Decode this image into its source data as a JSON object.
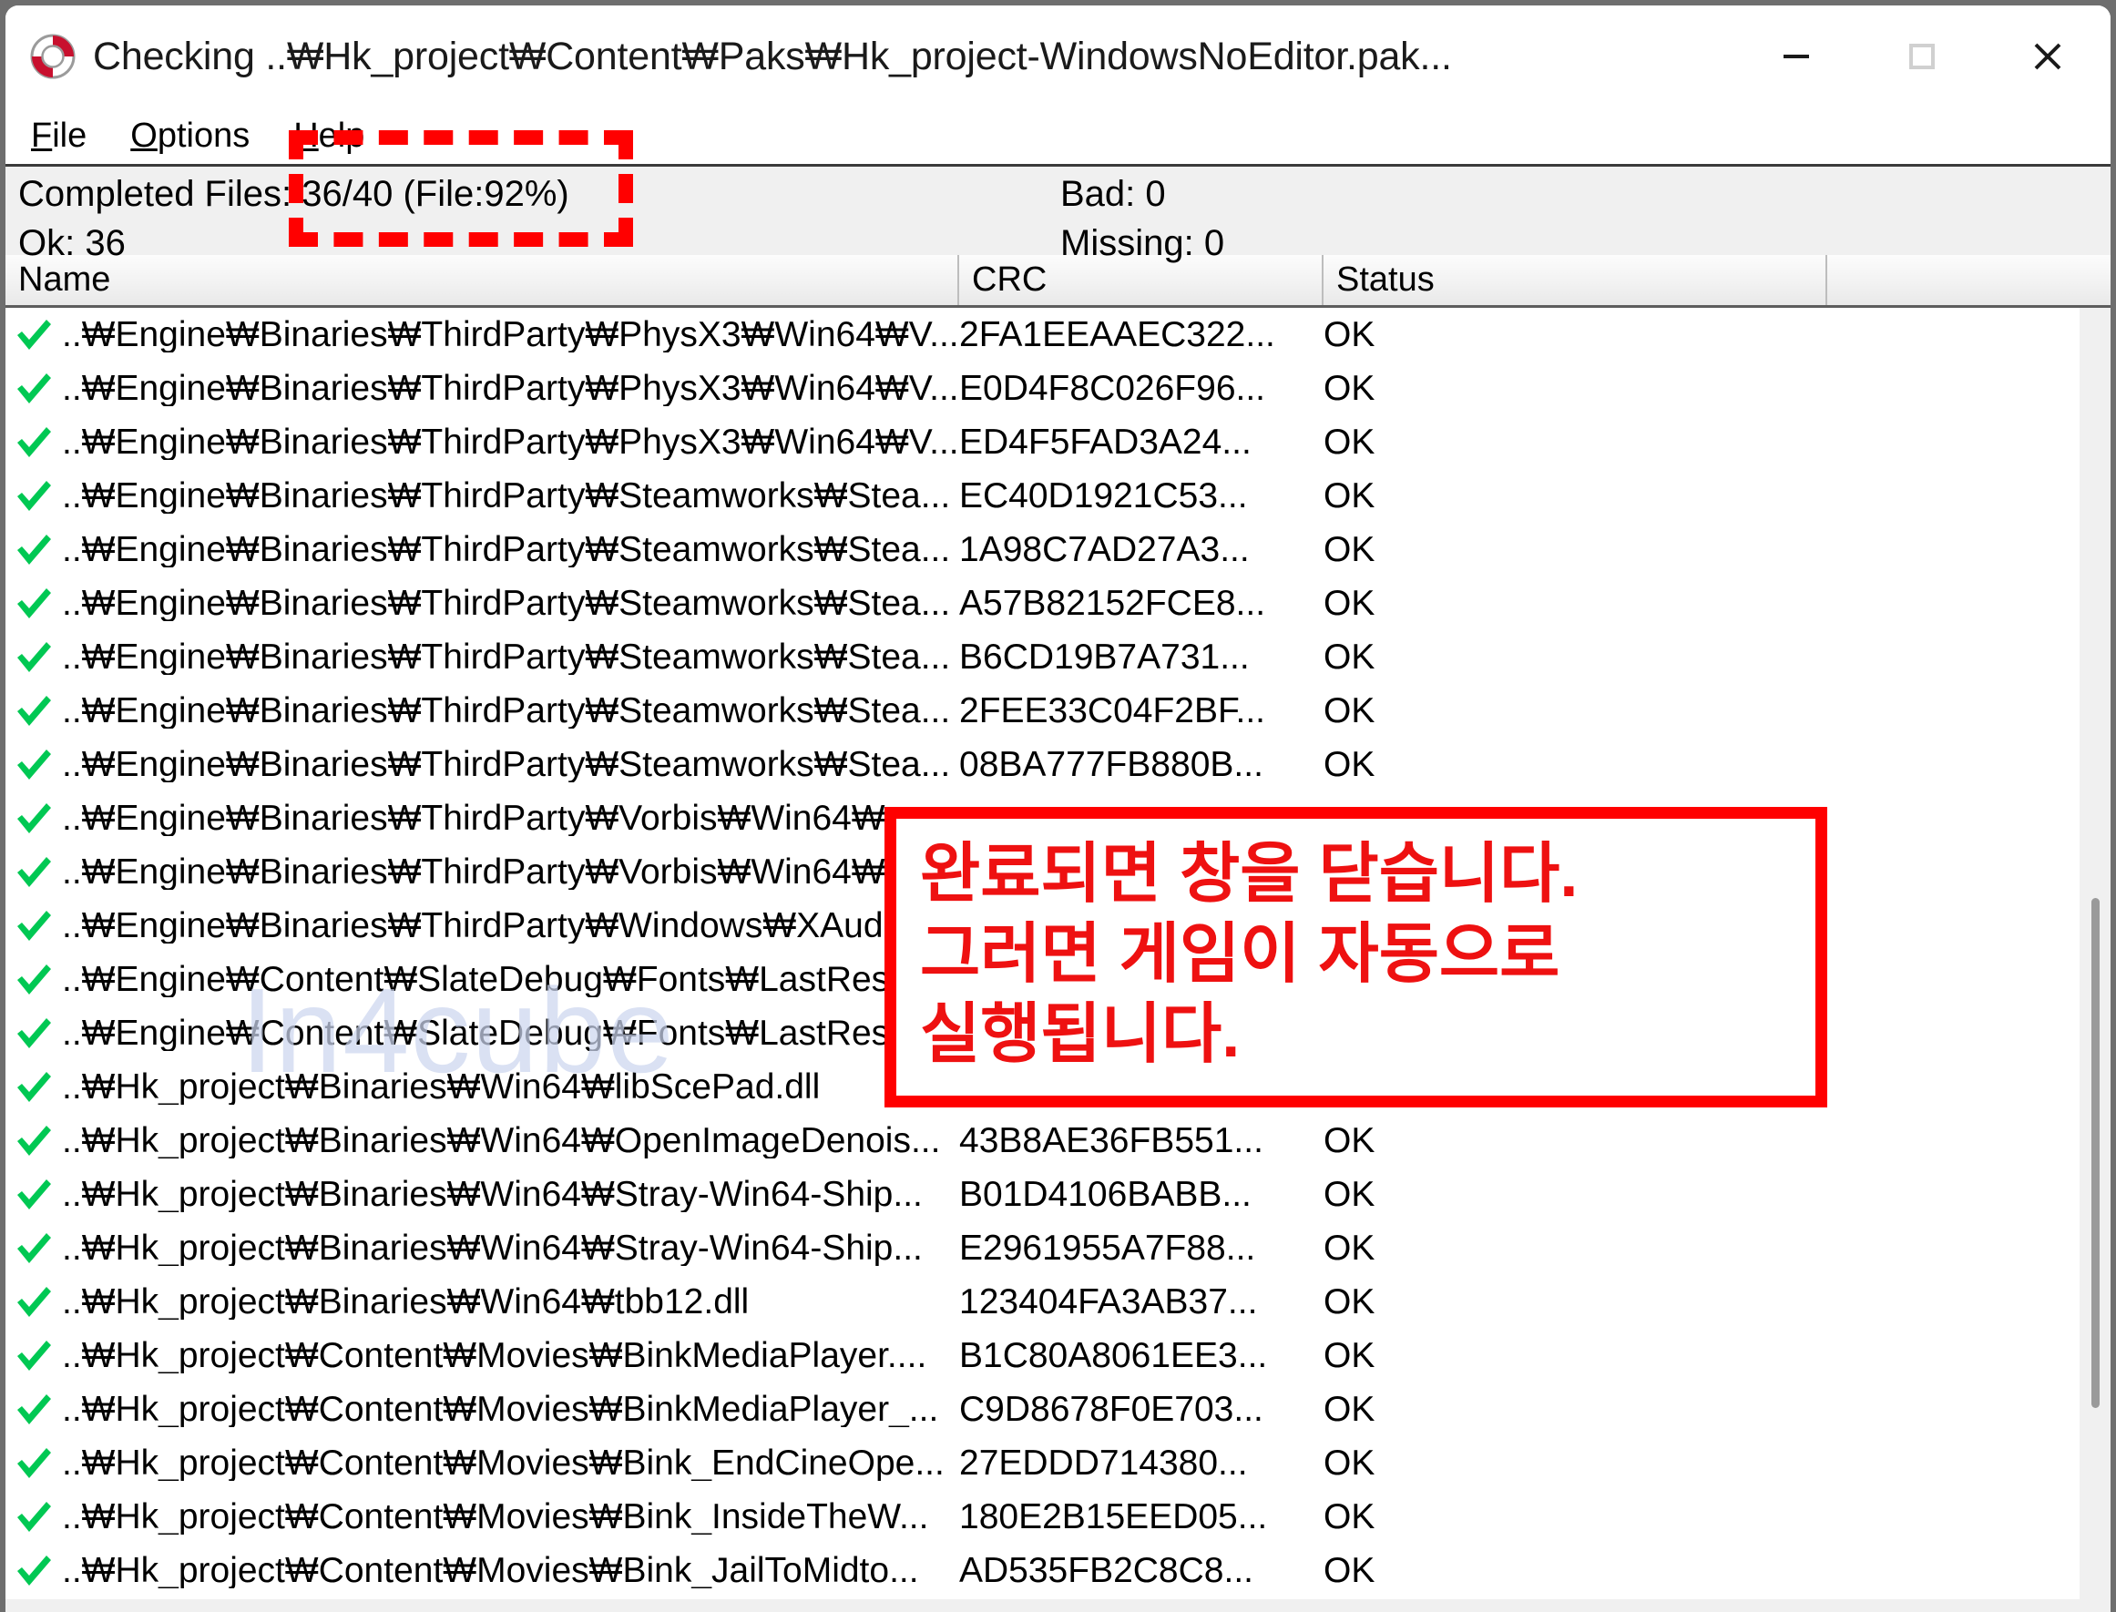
{
  "window": {
    "title": "Checking ..\\Hk_project\\Content\\Paks\\Hk_project-WindowsNoEditor.pak...",
    "icon": "lifebuoy-icon",
    "controls": {
      "minimize": "minimize-icon",
      "maximize": "maximize-icon",
      "close": "close-icon"
    }
  },
  "menu": {
    "items": [
      {
        "label": "File",
        "mnemonic": "F"
      },
      {
        "label": "Options",
        "mnemonic": "O"
      },
      {
        "label": "Help",
        "mnemonic": "H"
      }
    ]
  },
  "status": {
    "completed_files": "Completed Files: 36/40 (File:92%)",
    "ok": "Ok: 36",
    "bad": "Bad: 0",
    "missing": "Missing: 0",
    "completed_count": 36,
    "total_count": 40,
    "file_percent": 92,
    "ok_count": 36,
    "bad_count": 0,
    "missing_count": 0
  },
  "list": {
    "columns": [
      "Name",
      "CRC",
      "Status",
      ""
    ],
    "rows": [
      {
        "icon": "check-icon",
        "name": "..\\Engine\\Binaries\\ThirdParty\\PhysX3\\Win64\\V...",
        "crc": "2FA1EEAAEC322...",
        "status": "OK"
      },
      {
        "icon": "check-icon",
        "name": "..\\Engine\\Binaries\\ThirdParty\\PhysX3\\Win64\\V...",
        "crc": "E0D4F8C026F96...",
        "status": "OK"
      },
      {
        "icon": "check-icon",
        "name": "..\\Engine\\Binaries\\ThirdParty\\PhysX3\\Win64\\V...",
        "crc": "ED4F5FAD3A24...",
        "status": "OK"
      },
      {
        "icon": "check-icon",
        "name": "..\\Engine\\Binaries\\ThirdParty\\Steamworks\\Stea...",
        "crc": "EC40D1921C53...",
        "status": "OK"
      },
      {
        "icon": "check-icon",
        "name": "..\\Engine\\Binaries\\ThirdParty\\Steamworks\\Stea...",
        "crc": "1A98C7AD27A3...",
        "status": "OK"
      },
      {
        "icon": "check-icon",
        "name": "..\\Engine\\Binaries\\ThirdParty\\Steamworks\\Stea...",
        "crc": "A57B82152FCE8...",
        "status": "OK"
      },
      {
        "icon": "check-icon",
        "name": "..\\Engine\\Binaries\\ThirdParty\\Steamworks\\Stea...",
        "crc": "B6CD19B7A731...",
        "status": "OK"
      },
      {
        "icon": "check-icon",
        "name": "..\\Engine\\Binaries\\ThirdParty\\Steamworks\\Stea...",
        "crc": "2FEE33C04F2BF...",
        "status": "OK"
      },
      {
        "icon": "check-icon",
        "name": "..\\Engine\\Binaries\\ThirdParty\\Steamworks\\Stea...",
        "crc": "08BA777FB880B...",
        "status": "OK"
      },
      {
        "icon": "check-icon",
        "name": "..\\Engine\\Binaries\\ThirdParty\\Vorbis\\Win64\\...",
        "crc": "",
        "status": ""
      },
      {
        "icon": "check-icon",
        "name": "..\\Engine\\Binaries\\ThirdParty\\Vorbis\\Win64\\...",
        "crc": "",
        "status": ""
      },
      {
        "icon": "check-icon",
        "name": "..\\Engine\\Binaries\\ThirdParty\\Windows\\XAud...",
        "crc": "",
        "status": ""
      },
      {
        "icon": "check-icon",
        "name": "..\\Engine\\Content\\SlateDebug\\Fonts\\LastRes...",
        "crc": "",
        "status": ""
      },
      {
        "icon": "check-icon",
        "name": "..\\Engine\\Content\\SlateDebug\\Fonts\\LastRes...",
        "crc": "",
        "status": ""
      },
      {
        "icon": "check-icon",
        "name": "..\\Hk_project\\Binaries\\Win64\\libScePad.dll",
        "crc": "",
        "status": ""
      },
      {
        "icon": "check-icon",
        "name": "..\\Hk_project\\Binaries\\Win64\\OpenImageDenois...",
        "crc": "43B8AE36FB551...",
        "status": "OK"
      },
      {
        "icon": "check-icon",
        "name": "..\\Hk_project\\Binaries\\Win64\\Stray-Win64-Ship...",
        "crc": "B01D4106BABB...",
        "status": "OK"
      },
      {
        "icon": "check-icon",
        "name": "..\\Hk_project\\Binaries\\Win64\\Stray-Win64-Ship...",
        "crc": "E2961955A7F88...",
        "status": "OK"
      },
      {
        "icon": "check-icon",
        "name": "..\\Hk_project\\Binaries\\Win64\\tbb12.dll",
        "crc": "123404FA3AB37...",
        "status": "OK"
      },
      {
        "icon": "check-icon",
        "name": "..\\Hk_project\\Content\\Movies\\BinkMediaPlayer....",
        "crc": "B1C80A8061EE3...",
        "status": "OK"
      },
      {
        "icon": "check-icon",
        "name": "..\\Hk_project\\Content\\Movies\\BinkMediaPlayer_...",
        "crc": "C9D8678F0E703...",
        "status": "OK"
      },
      {
        "icon": "check-icon",
        "name": "..\\Hk_project\\Content\\Movies\\Bink_EndCineOpe...",
        "crc": "27EDDD714380...",
        "status": "OK"
      },
      {
        "icon": "check-icon",
        "name": "..\\Hk_project\\Content\\Movies\\Bink_InsideTheW...",
        "crc": "180E2B15EED05...",
        "status": "OK"
      },
      {
        "icon": "check-icon",
        "name": "..\\Hk_project\\Content\\Movies\\Bink_JailToMidto...",
        "crc": "AD535FB2C8C8...",
        "status": "OK"
      }
    ]
  },
  "watermark": {
    "text": "In4cube"
  },
  "annotations": {
    "highlight_box": {
      "target": "completed-files-progress",
      "style": "dashed-red"
    },
    "callout": {
      "lines": [
        "완료되면 창을 닫습니다.",
        "그러면 게임이 자동으로",
        "실행됩니다."
      ]
    }
  },
  "colors": {
    "annotation_red": "#ff0000",
    "callout_text_red": "#ee1111",
    "check_green": "#00c853",
    "watermark": "#ccd6ef",
    "panel_bg": "#f0f0f0"
  }
}
